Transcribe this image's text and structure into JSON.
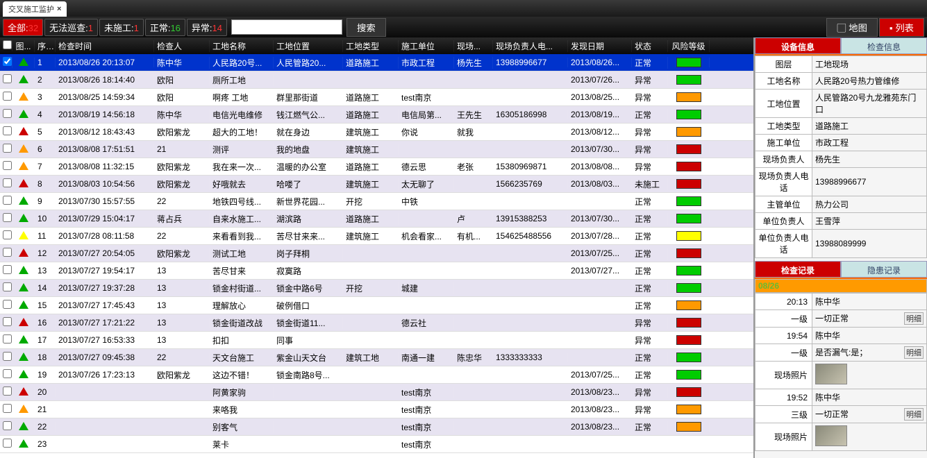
{
  "tab_title": "交叉施工监护",
  "filters": {
    "all": {
      "label": "全部:",
      "count": "32"
    },
    "nopatrol": {
      "label": "无法巡查:",
      "count": "1"
    },
    "nostart": {
      "label": "未施工:",
      "count": "1"
    },
    "normal": {
      "label": "正常:",
      "count": "16"
    },
    "abnormal": {
      "label": "异常:",
      "count": "14"
    }
  },
  "search_btn": "搜索",
  "toggle_map": "地图",
  "toggle_list": "列表",
  "columns": [
    "图...",
    "序...",
    "检查时间",
    "检查人",
    "工地名称",
    "工地位置",
    "工地类型",
    "施工单位",
    "现场...",
    "现场负责人电...",
    "发现日期",
    "状态",
    "风险等级"
  ],
  "rows": [
    {
      "n": "1",
      "time": "2013/08/26 20:13:07",
      "ins": "陈中华",
      "name": "人民路20号...",
      "loc": "人民管路20...",
      "type": "道路施工",
      "unit": "市政工程",
      "mgr": "杨先生",
      "tel": "13988996677",
      "date": "2013/08/26...",
      "stat": "正常",
      "risk": "#0c0",
      "tri": "#0a0"
    },
    {
      "n": "2",
      "time": "2013/08/26 18:14:40",
      "ins": "欧阳",
      "name": "厕所工地",
      "loc": "",
      "type": "",
      "unit": "",
      "mgr": "",
      "tel": "",
      "date": "2013/07/26...",
      "stat": "异常",
      "risk": "#0c0",
      "tri": "#0a0"
    },
    {
      "n": "3",
      "time": "2013/08/25 14:59:34",
      "ins": "欧阳",
      "name": "啊疼 工地",
      "loc": "群里那街道",
      "type": "道路施工",
      "unit": "test南京",
      "mgr": "",
      "tel": "",
      "date": "2013/08/25...",
      "stat": "异常",
      "risk": "#f90",
      "tri": "#f90"
    },
    {
      "n": "4",
      "time": "2013/08/19 14:56:18",
      "ins": "陈中华",
      "name": "电信光电维修",
      "loc": "钱江燃气公...",
      "type": "道路施工",
      "unit": "电信局第...",
      "mgr": "王先生",
      "tel": "16305186998",
      "date": "2013/08/19...",
      "stat": "正常",
      "risk": "#0c0",
      "tri": "#0a0"
    },
    {
      "n": "5",
      "time": "2013/08/12 18:43:43",
      "ins": "欧阳紫龙",
      "name": "超大的工地！",
      "loc": "就在身边",
      "type": "建筑施工",
      "unit": "你说",
      "mgr": "就我",
      "tel": "",
      "date": "2013/08/12...",
      "stat": "异常",
      "risk": "#f90",
      "tri": "#c00"
    },
    {
      "n": "6",
      "time": "2013/08/08 17:51:51",
      "ins": "21",
      "name": "测评",
      "loc": "我的地盘",
      "type": "建筑施工",
      "unit": "",
      "mgr": "",
      "tel": "",
      "date": "2013/07/30...",
      "stat": "异常",
      "risk": "#c00",
      "tri": "#f90"
    },
    {
      "n": "7",
      "time": "2013/08/08 11:32:15",
      "ins": "欧阳紫龙",
      "name": "我在来一次...",
      "loc": "温暖的办公室",
      "type": "道路施工",
      "unit": "德云思",
      "mgr": "老张",
      "tel": "15380969871",
      "date": "2013/08/08...",
      "stat": "异常",
      "risk": "#c00",
      "tri": "#f90"
    },
    {
      "n": "8",
      "time": "2013/08/03 10:54:56",
      "ins": "欧阳紫龙",
      "name": "好哦就去",
      "loc": "哈喽了",
      "type": "建筑施工",
      "unit": "太无聊了",
      "mgr": "",
      "tel": "1566235769",
      "date": "2013/08/03...",
      "stat": "未施工",
      "risk": "#c00",
      "tri": "#c00"
    },
    {
      "n": "9",
      "time": "2013/07/30 15:57:55",
      "ins": "22",
      "name": "地铁四号线...",
      "loc": "新世界花园...",
      "type": "开挖",
      "unit": "中铁",
      "mgr": "",
      "tel": "",
      "date": "",
      "stat": "正常",
      "risk": "#0c0",
      "tri": "#0a0"
    },
    {
      "n": "10",
      "time": "2013/07/29 15:04:17",
      "ins": "蒋占兵",
      "name": "自来水施工...",
      "loc": "湖滨路",
      "type": "道路施工",
      "unit": "",
      "mgr": "卢",
      "tel": "13915388253",
      "date": "2013/07/30...",
      "stat": "正常",
      "risk": "#0c0",
      "tri": "#0a0"
    },
    {
      "n": "11",
      "time": "2013/07/28 08:11:58",
      "ins": "22",
      "name": "来看看到我...",
      "loc": "苦尽甘来来...",
      "type": "建筑施工",
      "unit": "机会看家...",
      "mgr": "有机...",
      "tel": "154625488556",
      "date": "2013/07/28...",
      "stat": "正常",
      "risk": "#ff0",
      "tri": "#ff0"
    },
    {
      "n": "12",
      "time": "2013/07/27 20:54:05",
      "ins": "欧阳紫龙",
      "name": "测试工地",
      "loc": "岗子拜桐",
      "type": "",
      "unit": "",
      "mgr": "",
      "tel": "",
      "date": "2013/07/25...",
      "stat": "正常",
      "risk": "#c00",
      "tri": "#c00"
    },
    {
      "n": "13",
      "time": "2013/07/27 19:54:17",
      "ins": "13",
      "name": "苦尽甘来",
      "loc": "寂寞路",
      "type": "",
      "unit": "",
      "mgr": "",
      "tel": "",
      "date": "2013/07/27...",
      "stat": "正常",
      "risk": "#0c0",
      "tri": "#0a0"
    },
    {
      "n": "14",
      "time": "2013/07/27 19:37:28",
      "ins": "13",
      "name": "锁金村街道...",
      "loc": "锁金中路6号",
      "type": "开挖",
      "unit": "城建",
      "mgr": "",
      "tel": "",
      "date": "",
      "stat": "正常",
      "risk": "#0c0",
      "tri": "#0a0"
    },
    {
      "n": "15",
      "time": "2013/07/27 17:45:43",
      "ins": "13",
      "name": "理解放心",
      "loc": "破例借口",
      "type": "",
      "unit": "",
      "mgr": "",
      "tel": "",
      "date": "",
      "stat": "正常",
      "risk": "#f90",
      "tri": "#0a0"
    },
    {
      "n": "16",
      "time": "2013/07/27 17:21:22",
      "ins": "13",
      "name": "锁金街道改战",
      "loc": "锁金街道11...",
      "type": "",
      "unit": "德云社",
      "mgr": "",
      "tel": "",
      "date": "",
      "stat": "异常",
      "risk": "#c00",
      "tri": "#c00"
    },
    {
      "n": "17",
      "time": "2013/07/27 16:53:33",
      "ins": "13",
      "name": "扣扣",
      "loc": "同事",
      "type": "",
      "unit": "",
      "mgr": "",
      "tel": "",
      "date": "",
      "stat": "异常",
      "risk": "#c00",
      "tri": "#0a0"
    },
    {
      "n": "18",
      "time": "2013/07/27 09:45:38",
      "ins": "22",
      "name": "天文台施工",
      "loc": "紫金山天文台",
      "type": "建筑工地",
      "unit": "南通一建",
      "mgr": "陈忠华",
      "tel": "1333333333",
      "date": "",
      "stat": "正常",
      "risk": "#0c0",
      "tri": "#0a0"
    },
    {
      "n": "19",
      "time": "2013/07/26 17:23:13",
      "ins": "欧阳紫龙",
      "name": "这边不错！",
      "loc": "锁金南路8号...",
      "type": "",
      "unit": "",
      "mgr": "",
      "tel": "",
      "date": "2013/07/25...",
      "stat": "正常",
      "risk": "#0c0",
      "tri": "#0a0"
    },
    {
      "n": "20",
      "time": "",
      "ins": "",
      "name": "阿黄家驹",
      "loc": "",
      "type": "",
      "unit": "test南京",
      "mgr": "",
      "tel": "",
      "date": "2013/08/23...",
      "stat": "异常",
      "risk": "#c00",
      "tri": "#c00"
    },
    {
      "n": "21",
      "time": "",
      "ins": "",
      "name": "来咯我",
      "loc": "",
      "type": "",
      "unit": "test南京",
      "mgr": "",
      "tel": "",
      "date": "2013/08/23...",
      "stat": "异常",
      "risk": "#f90",
      "tri": "#f90"
    },
    {
      "n": "22",
      "time": "",
      "ins": "",
      "name": "别客气",
      "loc": "",
      "type": "",
      "unit": "test南京",
      "mgr": "",
      "tel": "",
      "date": "2013/08/23...",
      "stat": "正常",
      "risk": "#f90",
      "tri": "#0a0"
    },
    {
      "n": "23",
      "time": "",
      "ins": "",
      "name": "莱卡",
      "loc": "",
      "type": "",
      "unit": "test南京",
      "mgr": "",
      "tel": "",
      "date": "",
      "stat": "",
      "risk": "",
      "tri": "#0a0"
    }
  ],
  "right_tabs1": {
    "a": "设备信息",
    "b": "检查信息"
  },
  "info": [
    {
      "k": "图层",
      "v": "工地现场"
    },
    {
      "k": "工地名称",
      "v": "人民路20号热力管维修"
    },
    {
      "k": "工地位置",
      "v": "人民管路20号九龙雅苑东门口"
    },
    {
      "k": "工地类型",
      "v": "道路施工"
    },
    {
      "k": "施工单位",
      "v": "市政工程"
    },
    {
      "k": "现场负责人",
      "v": "杨先生"
    },
    {
      "k": "现场负责人电话",
      "v": "13988996677"
    },
    {
      "k": "主管单位",
      "v": "热力公司"
    },
    {
      "k": "单位负责人",
      "v": "王雪萍"
    },
    {
      "k": "单位负责人电话",
      "v": "13988089999"
    }
  ],
  "right_tabs2": {
    "a": "检查记录",
    "b": "隐患记录"
  },
  "rec_date": "08/26",
  "recs": [
    {
      "t": "20:13",
      "ins": "陈中华",
      "lv": "一级",
      "txt": "一切正常",
      "btn": "明细",
      "photo": false
    },
    {
      "t": "19:54",
      "ins": "陈中华",
      "lv": "一级",
      "txt": "是否漏气:是；",
      "btn": "明细",
      "photo": true
    },
    {
      "t": "19:52",
      "ins": "陈中华",
      "lv": "三级",
      "txt": "一切正常",
      "btn": "明细",
      "photo": true
    }
  ],
  "photo_label": "现场照片"
}
